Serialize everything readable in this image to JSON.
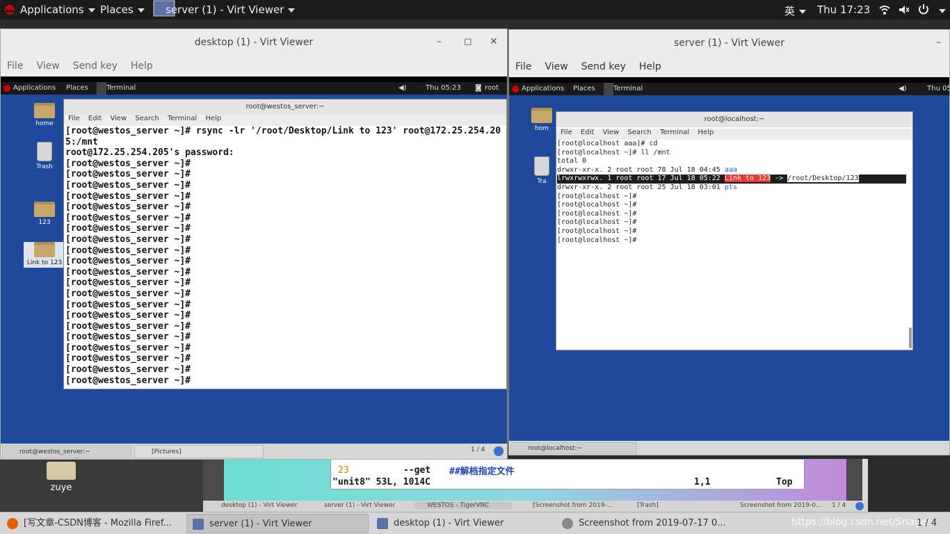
{
  "topbar": {
    "applications": "Applications",
    "places": "Places",
    "active_window": "server (1) - Virt Viewer",
    "input_method": "英",
    "clock": "Thu 17:23"
  },
  "desktop_window": {
    "title": "desktop (1) - Virt Viewer",
    "menu": [
      "File",
      "View",
      "Send key",
      "Help"
    ],
    "guest_bar": {
      "applications": "Applications",
      "places": "Places",
      "terminal": "Terminal",
      "clock": "Thu 05:23",
      "user": "root"
    },
    "icons": [
      "home",
      "Trash",
      "123",
      "Link to 123"
    ],
    "terminal": {
      "title": "root@westos_server:~",
      "menu": [
        "File",
        "Edit",
        "View",
        "Search",
        "Terminal",
        "Help"
      ],
      "lines": [
        "[root@westos_server ~]# rsync -lr '/root/Desktop/Link to 123' root@172.25.254.20",
        "5:/mnt",
        "root@172.25.254.205's password:",
        "[root@westos_server ~]#",
        "[root@westos_server ~]#",
        "[root@westos_server ~]#",
        "[root@westos_server ~]#",
        "[root@westos_server ~]#",
        "[root@westos_server ~]#",
        "[root@westos_server ~]#",
        "[root@westos_server ~]#",
        "[root@westos_server ~]#",
        "[root@westos_server ~]#",
        "[root@westos_server ~]#",
        "[root@westos_server ~]#",
        "[root@westos_server ~]#",
        "[root@westos_server ~]#",
        "[root@westos_server ~]#",
        "[root@westos_server ~]#",
        "[root@westos_server ~]#",
        "[root@westos_server ~]#",
        "[root@westos_server ~]#",
        "[root@westos_server ~]#",
        "[root@westos_server ~]#"
      ]
    },
    "taskbar": {
      "task1": "root@westos_server:~",
      "task2": "[Pictures]",
      "pager": "1 / 4"
    }
  },
  "server_window": {
    "title": "server (1) - Virt Viewer",
    "menu": [
      "File",
      "View",
      "Send key",
      "Help"
    ],
    "guest_bar": {
      "applications": "Applications",
      "places": "Places",
      "terminal": "Terminal",
      "clock": "Thu 05"
    },
    "icons": [
      "hom",
      "Tra"
    ],
    "terminal": {
      "title": "root@localhost:~",
      "menu": [
        "File",
        "Edit",
        "View",
        "Search",
        "Terminal",
        "Help"
      ],
      "lines_before": [
        "[root@localhost aaa]# cd",
        "[root@localhost ~]# ll /mnt",
        "total 0"
      ],
      "aaa_line": {
        "prefix": "drwxr-xr-x. 2 root root 78 Jul 18 04:45 ",
        "name": "aaa"
      },
      "link_line": {
        "perm": "lrwxrwxrwx. 1 root root 17 Jul 18 05:22 ",
        "name": "Link to 123",
        "arrow": " -> ",
        "target": "/root/Desktop/123"
      },
      "pts_line": {
        "prefix": "drwxr-xr-x. 2 root root 25 Jul 18 03:01 ",
        "name": "pts"
      },
      "lines_after": [
        "[root@localhost ~]#",
        "[root@localhost ~]#",
        "[root@localhost ~]#",
        "[root@localhost ~]#",
        "[root@localhost ~]#",
        "[root@localhost ~]#"
      ]
    },
    "taskbar": {
      "task1": "root@localhost:~"
    }
  },
  "background": {
    "desktop_icon": "zuye",
    "vim_line1_num": "23",
    "vim_line1_text": "--get",
    "vim_line1_comment": "##解档指定文件",
    "vim_status_file": "\"unit8\" 53L, 1014C",
    "vim_status_pos": "1,1",
    "vim_status_top": "Top",
    "vnc_tasks": [
      "desktop (1) - Virt Viewer",
      "server (1) - Virt Viewer",
      "WESTOS - TigerVNC",
      "[Screenshot from 2019-...",
      "[Trash]",
      "Screenshot from 2019-0..."
    ],
    "vnc_pager": "1 / 4"
  },
  "taskbar": {
    "firefox": "[写文章-CSDN博客 - Mozilla Firef...",
    "server": "server (1) - Virt Viewer",
    "desktop": "desktop (1) - Virt Viewer",
    "screenshot": "Screenshot from 2019-07-17 0...",
    "watermark": "https://blog.csdn.net/Sriagen",
    "pager": "1 / 4"
  },
  "colors": {
    "guest_desktop": "#1f4a9c",
    "link_highlight": "#e83a3a",
    "dir_blue": "#1f5fd0"
  }
}
